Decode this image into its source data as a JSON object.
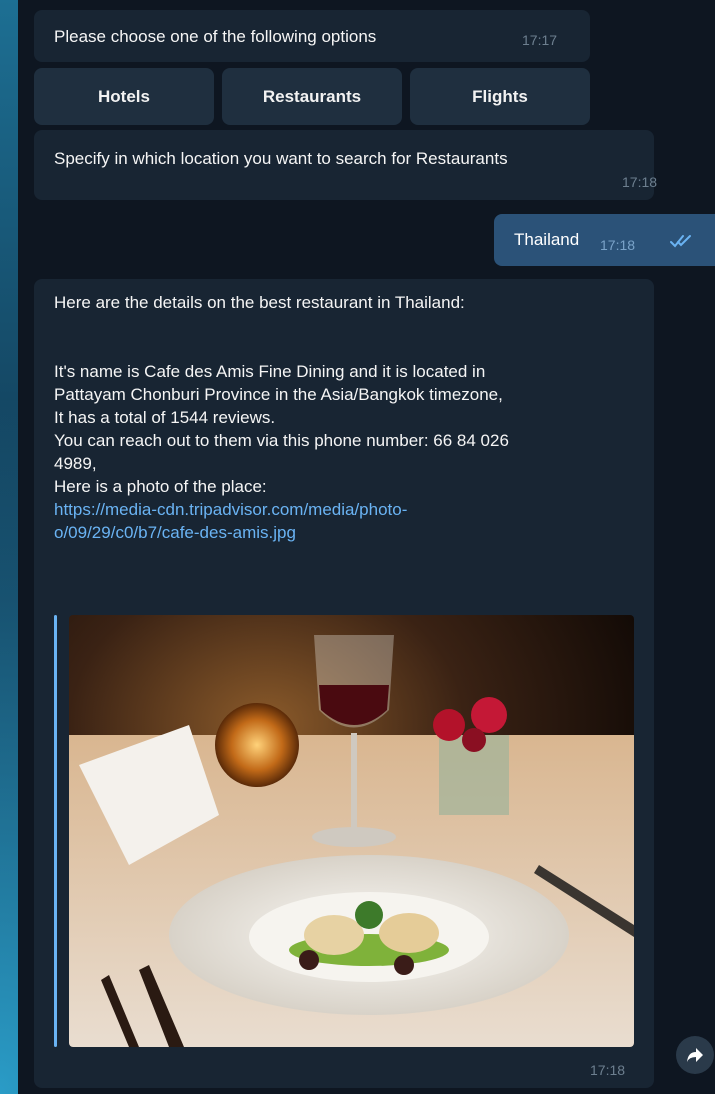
{
  "messages": {
    "prompt": {
      "text": "Please choose one of the following options",
      "time": "17:17"
    },
    "keyboard": {
      "buttons": [
        "Hotels",
        "Restaurants",
        "Flights"
      ]
    },
    "location_prompt": {
      "text": "Specify in which location you want to search for Restaurants",
      "time": "17:18"
    },
    "user_reply": {
      "text": "Thailand",
      "time": "17:18",
      "status_icon": "double-check-icon"
    },
    "details": {
      "intro": "Here are the details on the best restaurant in Thailand:",
      "line1": "It's name is Cafe des Amis Fine Dining and it is located in",
      "line2": "Pattayam Chonburi Province in the Asia/Bangkok timezone,",
      "line3": "It has a total of 1544 reviews.",
      "line4": "You can reach out to them via this phone number: 66 84 026",
      "line5": "4989,",
      "line6": "Here is a photo of the place:",
      "link_line1": "https://media-cdn.tripadvisor.com/media/photo-",
      "link_line2": "o/09/29/c0/b7/cafe-des-amis.jpg",
      "time": "17:18"
    }
  },
  "share_icon": "forward-arrow-icon",
  "colors": {
    "chat_background": "#0e1621",
    "incoming_bubble": "#182533",
    "outgoing_bubble": "#2b5278",
    "link": "#6ab3f3"
  }
}
